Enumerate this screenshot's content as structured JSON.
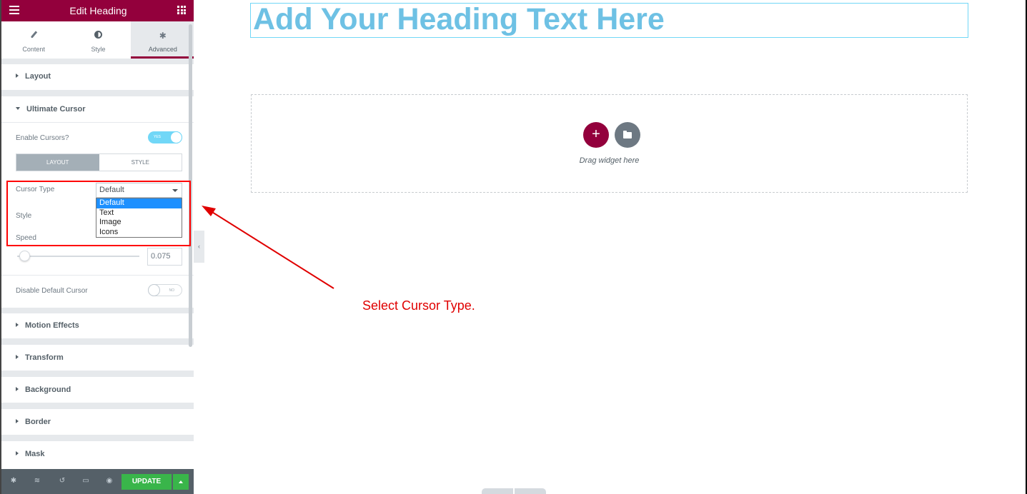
{
  "panel": {
    "title": "Edit Heading",
    "tabs": [
      {
        "label": "Content",
        "icon": "pencil-icon"
      },
      {
        "label": "Style",
        "icon": "contrast-icon"
      },
      {
        "label": "Advanced",
        "icon": "gear-icon"
      }
    ],
    "active_tab": "Advanced",
    "sections": {
      "layout": "Layout",
      "ultimate_cursor": "Ultimate Cursor",
      "motion_effects": "Motion Effects",
      "transform": "Transform",
      "background": "Background",
      "border": "Border",
      "mask": "Mask"
    },
    "cursor": {
      "enable_label": "Enable Cursors?",
      "enable_toggle_text": "YES",
      "enable_on": true,
      "seg_layout": "LAYOUT",
      "seg_style": "STYLE",
      "cursor_type_label": "Cursor Type",
      "cursor_type_value": "Default",
      "cursor_type_options": [
        "Default",
        "Text",
        "Image",
        "Icons"
      ],
      "style_label": "Style",
      "speed_label": "Speed",
      "speed_value": "0.075",
      "disable_label": "Disable Default Cursor",
      "disable_toggle_text": "NO",
      "disable_on": false
    },
    "footer": {
      "update_label": "UPDATE",
      "icons": [
        "gear-icon",
        "layers-icon",
        "history-icon",
        "responsive-icon",
        "eye-icon"
      ]
    }
  },
  "canvas": {
    "heading": "Add Your Heading Text Here",
    "drag_text": "Drag widget here",
    "annotation": "Select Cursor Type."
  },
  "colors": {
    "brand": "#93003c",
    "heading": "#6ec1e4",
    "toggle_on": "#71d7f7",
    "update": "#39b54a",
    "annotation": "#e00000"
  }
}
